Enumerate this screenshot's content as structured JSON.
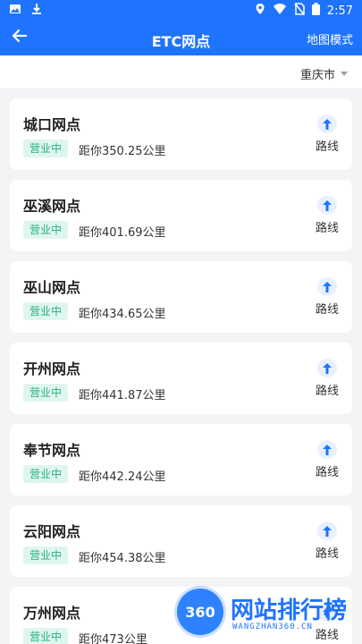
{
  "status_bar": {
    "time": "2:57",
    "icons": [
      "image-icon",
      "download-icon",
      "location-icon",
      "wifi-icon",
      "no-sim-icon",
      "battery-icon"
    ]
  },
  "app_bar": {
    "title": "ETC网点",
    "map_mode_label": "地图模式",
    "colors": {
      "background": "#1e73ff",
      "text": "#ffffff"
    }
  },
  "filter": {
    "city": "重庆市"
  },
  "cards": [
    {
      "name": "城口网点",
      "status": "营业中",
      "distance": "距你350.25公里",
      "route_label": "路线"
    },
    {
      "name": "巫溪网点",
      "status": "营业中",
      "distance": "距你401.69公里",
      "route_label": "路线"
    },
    {
      "name": "巫山网点",
      "status": "营业中",
      "distance": "距你434.65公里",
      "route_label": "路线"
    },
    {
      "name": "开州网点",
      "status": "营业中",
      "distance": "距你441.87公里",
      "route_label": "路线"
    },
    {
      "name": "奉节网点",
      "status": "营业中",
      "distance": "距你442.24公里",
      "route_label": "路线"
    },
    {
      "name": "云阳网点",
      "status": "营业中",
      "distance": "距你454.38公里",
      "route_label": "路线"
    },
    {
      "name": "万州网点",
      "status": "营业中",
      "distance": "距你473公里",
      "route_label": "路线"
    }
  ],
  "watermark": {
    "logo_text": "360",
    "title": "网站排行榜",
    "subtitle": "WANGZHAN360.CN"
  }
}
